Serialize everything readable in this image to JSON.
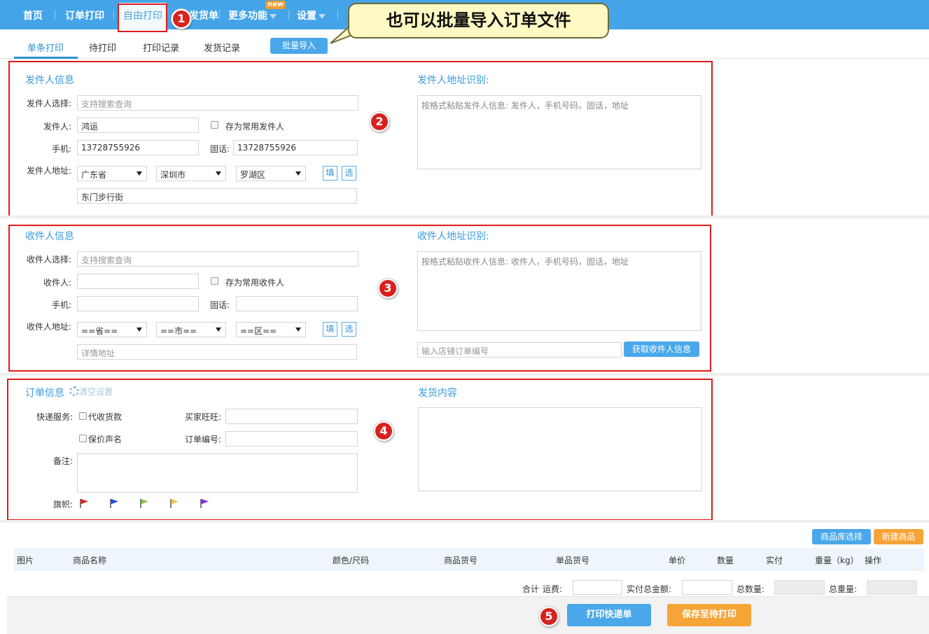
{
  "nav": {
    "items": [
      "首页",
      "订单打印",
      "自由打印",
      "发货单",
      "更多功能",
      "设置"
    ],
    "new_badge": "new"
  },
  "callout": {
    "text": "也可以批量导入订单文件"
  },
  "subnav": {
    "tabs": [
      "单条打印",
      "待打印",
      "打印记录",
      "发货记录"
    ],
    "batch_import": "批量导入"
  },
  "sender": {
    "title": "发件人信息",
    "select_label": "发件人选择:",
    "select_placeholder": "支持搜索查询",
    "name_label": "发件人:",
    "name_value": "鸿运",
    "save_common": "存为常用发件人",
    "mobile_label": "手机:",
    "mobile_value": "13728755926",
    "phone_label": "固话:",
    "phone_value": "13728755926",
    "address_label": "发件人地址:",
    "province": "广东省",
    "city": "深圳市",
    "district": "罗湖区",
    "fill_btn": "填",
    "choose_btn": "选",
    "street": "东门步行街",
    "recognize_title": "发件人地址识别:",
    "recognize_placeholder": "按格式粘贴发件人信息: 发件人，手机号码，固话，地址"
  },
  "receiver": {
    "title": "收件人信息",
    "select_label": "收件人选择:",
    "select_placeholder": "支持搜索查询",
    "name_label": "收件人:",
    "save_common": "存为常用收件人",
    "mobile_label": "手机:",
    "phone_label": "固话:",
    "address_label": "收件人地址:",
    "province": "==省==",
    "city": "==市==",
    "district": "==区==",
    "fill_btn": "填",
    "choose_btn": "选",
    "detail_placeholder": "详情地址",
    "recognize_title": "收件人地址识别:",
    "recognize_placeholder": "按格式粘贴收件人信息: 收件人，手机号码，固话，地址",
    "shop_order_placeholder": "输入店铺订单编号",
    "get_info_btn": "获取收件人信息"
  },
  "order": {
    "title": "订单信息",
    "clear_settings": "清空设置",
    "express_label": "快递服务:",
    "cod": "代收货款",
    "insured": "保价声名",
    "buyer_label": "买家旺旺:",
    "order_no_label": "订单编号:",
    "remark_label": "备注:",
    "flag_label": "旗帜:",
    "flag_colors": [
      "#e8231b",
      "#1f4fe0",
      "#8cc63f",
      "#f5c242",
      "#8a2be2"
    ],
    "ship_content_title": "发货内容"
  },
  "goods": {
    "lib_btn": "商品库选择",
    "new_btn": "新建商品",
    "columns": [
      "图片",
      "商品名称",
      "颜色/尺码",
      "商品货号",
      "单品货号",
      "单价",
      "数量",
      "实付",
      "重量（kg）",
      "操作"
    ],
    "total_label": "合计",
    "freight_label": "运费:",
    "paid_total_label": "实付总金额:",
    "total_qty_label": "总数量:",
    "total_weight_label": "总重量:"
  },
  "footer": {
    "print_btn": "打印快递单",
    "save_btn": "保存至待打印"
  },
  "markers": [
    "1",
    "2",
    "3",
    "4",
    "5"
  ],
  "colors": {
    "accent": "#44a4e8",
    "highlight": "#e01b1b",
    "orange": "#f5a437"
  }
}
